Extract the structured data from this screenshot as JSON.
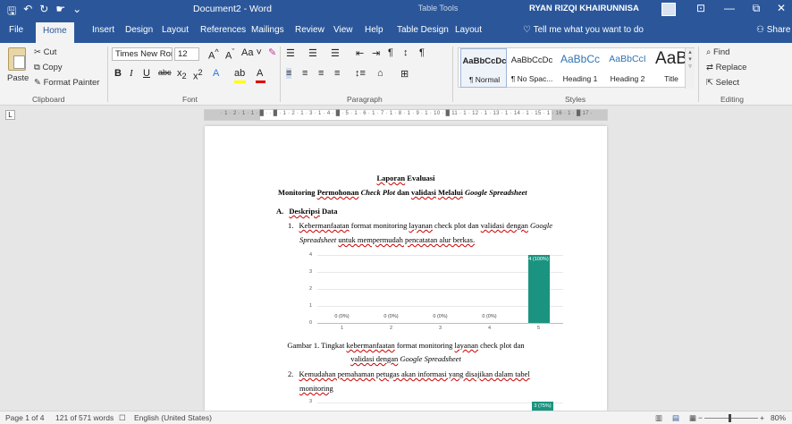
{
  "titlebar": {
    "doc_title": "Document2  -  Word",
    "context": "Table Tools",
    "user": "RYAN RIZQI KHAIRUNNISA",
    "qat": {
      "save": "🖫",
      "undo": "↶",
      "redo": "↻",
      "touch": "☛",
      "more": "⌄"
    },
    "controls": {
      "ribbon": "⊡",
      "min": "—",
      "restore": "⧉",
      "close": "✕"
    }
  },
  "tabs": [
    "File",
    "Home",
    "Insert",
    "Design",
    "Layout",
    "References",
    "Mailings",
    "Review",
    "View",
    "Help",
    "Table Design",
    "Layout"
  ],
  "tell_me": "Tell me what you want to do",
  "share": "Share",
  "clipboard": {
    "paste": "Paste",
    "cut": "Cut",
    "copy": "Copy",
    "format_painter": "Format Painter",
    "label": "Clipboard"
  },
  "font": {
    "name": "Times New Roma",
    "size": "12",
    "label": "Font"
  },
  "paragraph": {
    "label": "Paragraph"
  },
  "styles": {
    "label": "Styles",
    "items": [
      {
        "preview": "AaBbCcDc",
        "name": "¶ Normal"
      },
      {
        "preview": "AaBbCcDc",
        "name": "¶ No Spac..."
      },
      {
        "preview": "AaBbCc",
        "name": "Heading 1"
      },
      {
        "preview": "AaBbCcI",
        "name": "Heading 2"
      },
      {
        "preview": "AaB",
        "name": "Title"
      }
    ]
  },
  "editing": {
    "find": "Find",
    "replace": "Replace",
    "select": "Select",
    "label": "Editing"
  },
  "ruler": {
    "numbers": "· 1 · 2 · 1 · 1 · █ · · █ · 1 · 2 · 1 · 3 · 1 · 4 · █ · 5 · 1 · 6 · 1 · 7 · 1 · 8 · 1 · 9 · 1 · 10 · █ 11 · 1 · 12 · 1 · 13 · 1 · 14 · 1 · 15 · 1 · 16 · 1 · █ 17 ·"
  },
  "document": {
    "title_bold": "Laporan",
    "title_rest": "Evaluasi",
    "subtitle_a": "Monitoring",
    "subtitle_b": "Permohonan",
    "subtitle_c": "Check Plot",
    "subtitle_d": "dan",
    "subtitle_e": "validasi",
    "subtitle_f": "Melalui",
    "subtitle_g": "Google Spreadsheet",
    "section_a": "A.",
    "section_a_title": "Deskripsi",
    "section_a_rest": "Data",
    "item1_num": "1.",
    "item1_line1_a": "Kebermanfaatan",
    "item1_line1_b": "format monitoring",
    "item1_line1_c": "layanan",
    "item1_line1_d": "check plot dan",
    "item1_line1_e": "validasi dengan",
    "item1_line1_f": "Google",
    "item1_line2_a": "Spreadsheet",
    "item1_line2_b": "untuk mempermudah pencatatan  alur berkas.",
    "caption1_a": "Gambar 1. Tingkat",
    "caption1_b": "kebermanfaatan",
    "caption1_c": "format monitoring",
    "caption1_d": "layanan",
    "caption1_e": "check plot dan",
    "caption1_f": "validasi dengan",
    "caption1_g": "Google Spreadsheet",
    "item2_num": "2.",
    "item2_line1": "Kemudahan  pemahaman  petugas  akan  informasi  yang  disajikan  dalam  tabel",
    "item2_line2": "monitoring"
  },
  "chart_data": [
    {
      "type": "bar",
      "categories": [
        "1",
        "2",
        "3",
        "4",
        "5"
      ],
      "values": [
        0,
        0,
        0,
        0,
        4
      ],
      "data_labels": [
        "0 (0%)",
        "0 (0%)",
        "0 (0%)",
        "0 (0%)",
        "4 (100%)"
      ],
      "yticks": [
        "0",
        "1",
        "2",
        "3",
        "4"
      ],
      "ylim": [
        0,
        4
      ],
      "color": "#1a9480",
      "grid": true
    },
    {
      "type": "bar",
      "yticks": [
        "3"
      ],
      "data_labels": [
        "3 (75%)"
      ],
      "color": "#1a9480"
    }
  ],
  "status": {
    "page": "Page 1 of 4",
    "words": "121 of 571 words",
    "lang": "English (United States)",
    "zoom": "80%"
  },
  "colors": {
    "accent": "#2b579a",
    "bar": "#1a9480"
  }
}
